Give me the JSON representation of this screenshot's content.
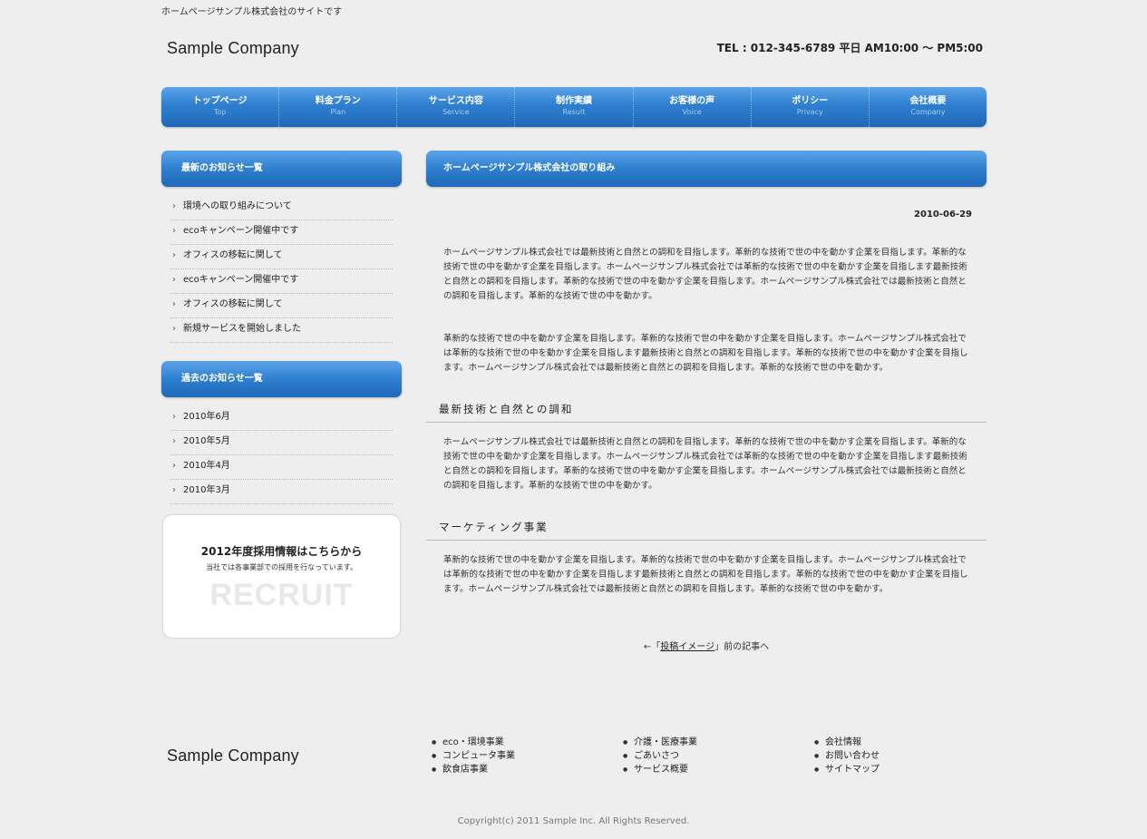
{
  "header": {
    "tagline": "ホームページサンプル株式会社のサイトです",
    "logo": "Sample Company",
    "contact": "TEL : 012-345-6789  平日 AM10:00 ～ PM5:00"
  },
  "gnav": [
    {
      "label": "トップページ",
      "sub": "Top"
    },
    {
      "label": "料金プラン",
      "sub": "Plan"
    },
    {
      "label": "サービス内容",
      "sub": "Service"
    },
    {
      "label": "制作実績",
      "sub": "Result"
    },
    {
      "label": "お客様の声",
      "sub": "Voice"
    },
    {
      "label": "ポリシー",
      "sub": "Privacy"
    },
    {
      "label": "会社概要",
      "sub": "Company"
    }
  ],
  "sidebar": {
    "latest_title": "最新のお知らせ一覧",
    "latest": [
      "環境への取り組みについて",
      "ecoキャンペーン開催中です",
      "オフィスの移転に関して",
      "ecoキャンペーン開催中です",
      "オフィスの移転に関して",
      "新規サービスを開始しました"
    ],
    "archive_title": "過去のお知らせ一覧",
    "archive": [
      "2010年6月",
      "2010年5月",
      "2010年4月",
      "2010年3月"
    ],
    "recruit": {
      "title": "2012年度採用情報はこちらから",
      "text": "当社では各事業部での採用を行なっています。",
      "big": "RECRUIT"
    }
  },
  "main": {
    "title": "ホームページサンプル株式会社の取り組み",
    "date": "2010-06-29",
    "p1": "ホームページサンプル株式会社では最新技術と自然との調和を目指します。革新的な技術で世の中を動かす企業を目指します。革新的な技術で世の中を動かす企業を目指します。ホームページサンプル株式会社では革新的な技術で世の中を動かす企業を目指します最新技術と自然との調和を目指します。革新的な技術で世の中を動かす企業を目指します。ホームページサンプル株式会社では最新技術と自然との調和を目指します。革新的な技術で世の中を動かす。",
    "p2": "革新的な技術で世の中を動かす企業を目指します。革新的な技術で世の中を動かす企業を目指します。ホームページサンプル株式会社では革新的な技術で世の中を動かす企業を目指します最新技術と自然との調和を目指します。革新的な技術で世の中を動かす企業を目指します。ホームページサンプル株式会社では最新技術と自然との調和を目指します。革新的な技術で世の中を動かす。",
    "h1": "最新技術と自然との調和",
    "p3": "ホームページサンプル株式会社では最新技術と自然との調和を目指します。革新的な技術で世の中を動かす企業を目指します。革新的な技術で世の中を動かす企業を目指します。ホームページサンプル株式会社では革新的な技術で世の中を動かす企業を目指します最新技術と自然との調和を目指します。革新的な技術で世の中を動かす企業を目指します。ホームページサンプル株式会社では最新技術と自然との調和を目指します。革新的な技術で世の中を動かす。",
    "h2": "マーケティング事業",
    "p4": "革新的な技術で世の中を動かす企業を目指します。革新的な技術で世の中を動かす企業を目指します。ホームページサンプル株式会社では革新的な技術で世の中を動かす企業を目指します最新技術と自然との調和を目指します。革新的な技術で世の中を動かす企業を目指します。ホームページサンプル株式会社では最新技術と自然との調和を目指します。革新的な技術で世の中を動かす。",
    "pager_prefix": "←「",
    "pager_link": "投稿イメージ",
    "pager_suffix": "」前の記事へ"
  },
  "footer": {
    "logo": "Sample Company",
    "col1": [
      "eco・環境事業",
      "コンピュータ事業",
      "飲食店事業"
    ],
    "col2": [
      "介護・医療事業",
      "ごあいさつ",
      "サービス概要"
    ],
    "col3": [
      "会社情報",
      "お問い合わせ",
      "サイトマップ"
    ],
    "copyright": "Copyright(c) 2011 Sample Inc. All Rights Reserved."
  }
}
